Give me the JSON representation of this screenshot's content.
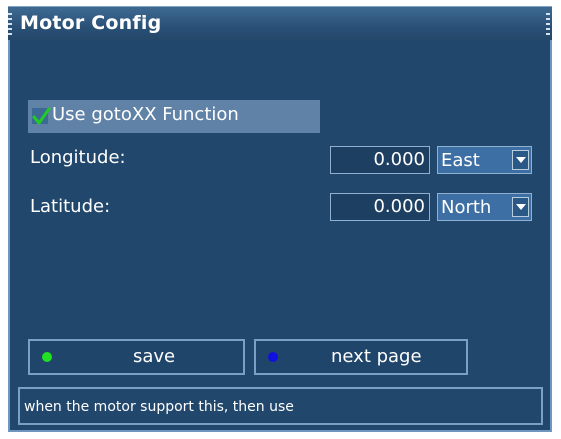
{
  "window": {
    "title": "Motor Config"
  },
  "goto": {
    "label": "Use gotoXX Function",
    "checked": true
  },
  "longitude": {
    "label": "Longitude:",
    "value": "0.000",
    "direction": "East"
  },
  "latitude": {
    "label": "Latitude:",
    "value": "0.000",
    "direction": "North"
  },
  "buttons": {
    "save": {
      "label": "save",
      "color": "#22e022"
    },
    "next_page": {
      "label": "next page",
      "color": "#1010e0"
    }
  },
  "help": {
    "text": "when the motor support this, then use"
  },
  "colors": {
    "panel": "#21476c",
    "title": "#2a5076",
    "highlight": "#5f82a6",
    "check": "#22cc22"
  }
}
